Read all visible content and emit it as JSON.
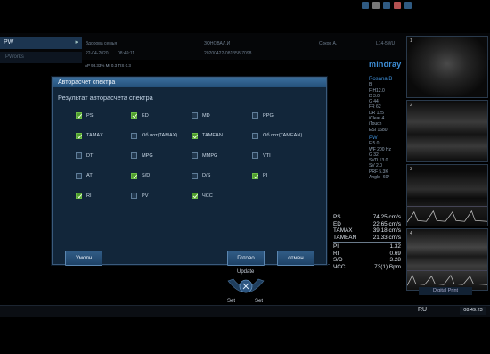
{
  "top": {
    "mode_tab": "PW",
    "mode_sub": "PWorks",
    "patient_name": "Здорова семья",
    "date": "22-04-2020",
    "time_top": "08:49:11",
    "hospital": "ЗОНОВАЛ.И",
    "exam_id": "20200422-081358-7098",
    "operator": "Соков А.",
    "probe": "L14-5WU",
    "depth_readout": "AP 93.33%  MI 0.3  TIS 0.3"
  },
  "logo": "mindray",
  "params": {
    "b_section": "Rosana B",
    "b_mode": "B",
    "b_lines": [
      "F H12.0",
      "D 3.0",
      "G 44",
      "FR 62",
      "DR 125",
      "iClear 4",
      "iTouch",
      "ESI 1680"
    ],
    "pw_section": "PW",
    "pw_lines": [
      "F 5.0",
      "WF 200 Hz",
      "G 32",
      "SVD 13.0",
      "SV 2.0",
      "PRF 5.3K",
      "Angle -60°"
    ]
  },
  "thumbnails": [
    "1",
    "2",
    "3",
    "4"
  ],
  "digital_print": "Digital Print",
  "readings": [
    {
      "label": "PS",
      "value": "74.25 cm/s"
    },
    {
      "label": "ED",
      "value": "22.65 cm/s"
    },
    {
      "label": "TAMAX",
      "value": "39.18 cm/s"
    },
    {
      "label": "TAMEAN",
      "value": "21.33 cm/s"
    },
    {
      "label": "PI",
      "value": "1.32"
    },
    {
      "label": "RI",
      "value": "0.69"
    },
    {
      "label": "S/D",
      "value": "3.28"
    },
    {
      "label": "ЧСС",
      "value": "73(1) Bpm"
    }
  ],
  "trackball": {
    "update": "Update",
    "set_left": "Set",
    "set_right": "Set"
  },
  "taskbar": {
    "lang": "RU",
    "clock": "08:49:23"
  },
  "dialog": {
    "title": "Авторасчет спектра",
    "section_title": "Результат авторасчета спектра",
    "rows": [
      [
        {
          "label": "PS",
          "checked": true
        },
        {
          "label": "ED",
          "checked": true
        },
        {
          "label": "MD",
          "checked": false
        },
        {
          "label": "PPG",
          "checked": false
        }
      ],
      [
        {
          "label": "TAMAX",
          "checked": true
        },
        {
          "label": "Об пот(TAMAX)",
          "checked": false
        },
        {
          "label": "TAMEAN",
          "checked": true
        },
        {
          "label": "Об пот(TAMEAN)",
          "checked": false
        }
      ],
      [
        {
          "label": "DT",
          "checked": false
        },
        {
          "label": "MPG",
          "checked": false
        },
        {
          "label": "MMPG",
          "checked": false
        },
        {
          "label": "VTI",
          "checked": false
        }
      ],
      [
        {
          "label": "AT",
          "checked": false
        },
        {
          "label": "S/D",
          "checked": true
        },
        {
          "label": "D/S",
          "checked": false
        },
        {
          "label": "PI",
          "checked": true
        }
      ],
      [
        {
          "label": "RI",
          "checked": true
        },
        {
          "label": "PV",
          "checked": false
        },
        {
          "label": "ЧСС",
          "checked": true
        }
      ]
    ],
    "buttons": {
      "default": "Умолч",
      "ok": "Готово",
      "cancel": "отмен"
    }
  },
  "colors": {
    "accent": "#3e8fd8",
    "checkbox_on": "#4e9d2c",
    "dialog_bg": "#12263a",
    "title_bar": "#2d6090"
  }
}
